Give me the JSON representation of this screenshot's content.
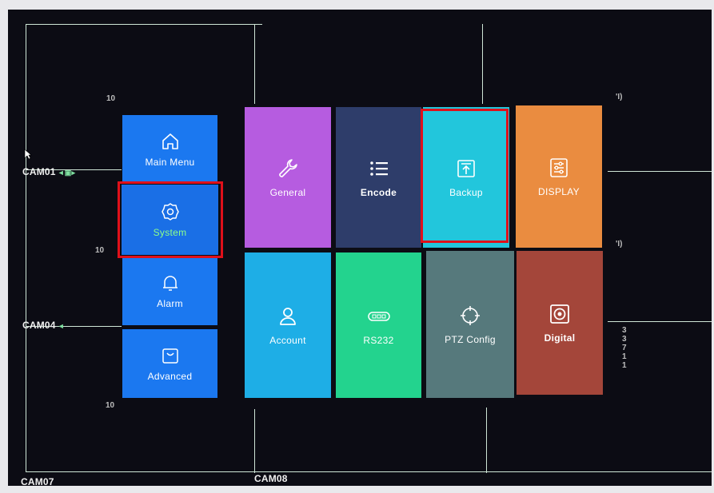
{
  "cameras": {
    "cam01": "CAM01",
    "cam04": "CAM04",
    "cam07": "CAM07",
    "cam08": "CAM08"
  },
  "overlay_text": {
    "top_left": "10",
    "mid_left": "10",
    "bottom_left": "10",
    "right_mid": "'I)",
    "top_right": "'I)",
    "right_chars": "3\n3\n7\n1\n1"
  },
  "side_menu": {
    "items": [
      {
        "label": "Main Menu",
        "icon": "home-icon"
      },
      {
        "label": "System",
        "icon": "gear-icon",
        "selected": true
      },
      {
        "label": "Alarm",
        "icon": "bell-icon"
      },
      {
        "label": "Advanced",
        "icon": "bag-icon"
      }
    ]
  },
  "settings_grid": {
    "tiles": [
      {
        "label": "General",
        "icon": "wrench-icon",
        "color": "#b65ce0"
      },
      {
        "label": "Encode",
        "icon": "list-icon",
        "color": "#2e3d6a"
      },
      {
        "label": "Backup",
        "icon": "upload-icon",
        "color": "#22c6dc",
        "highlighted": true
      },
      {
        "label": "DISPLAY",
        "icon": "sliders-icon",
        "color": "#ea8c40"
      },
      {
        "label": "Account",
        "icon": "user-icon",
        "color": "#1eaee6"
      },
      {
        "label": "RS232",
        "icon": "port-icon",
        "color": "#23d38e"
      },
      {
        "label": "PTZ Config",
        "icon": "crosshair-icon",
        "color": "#56797c"
      },
      {
        "label": "Digital",
        "icon": "speaker-icon",
        "color": "#a4463a"
      }
    ]
  },
  "colors": {
    "highlight_border": "#e0101a",
    "side_menu": "#1b78f0",
    "selected_label": "#8dff8a"
  }
}
